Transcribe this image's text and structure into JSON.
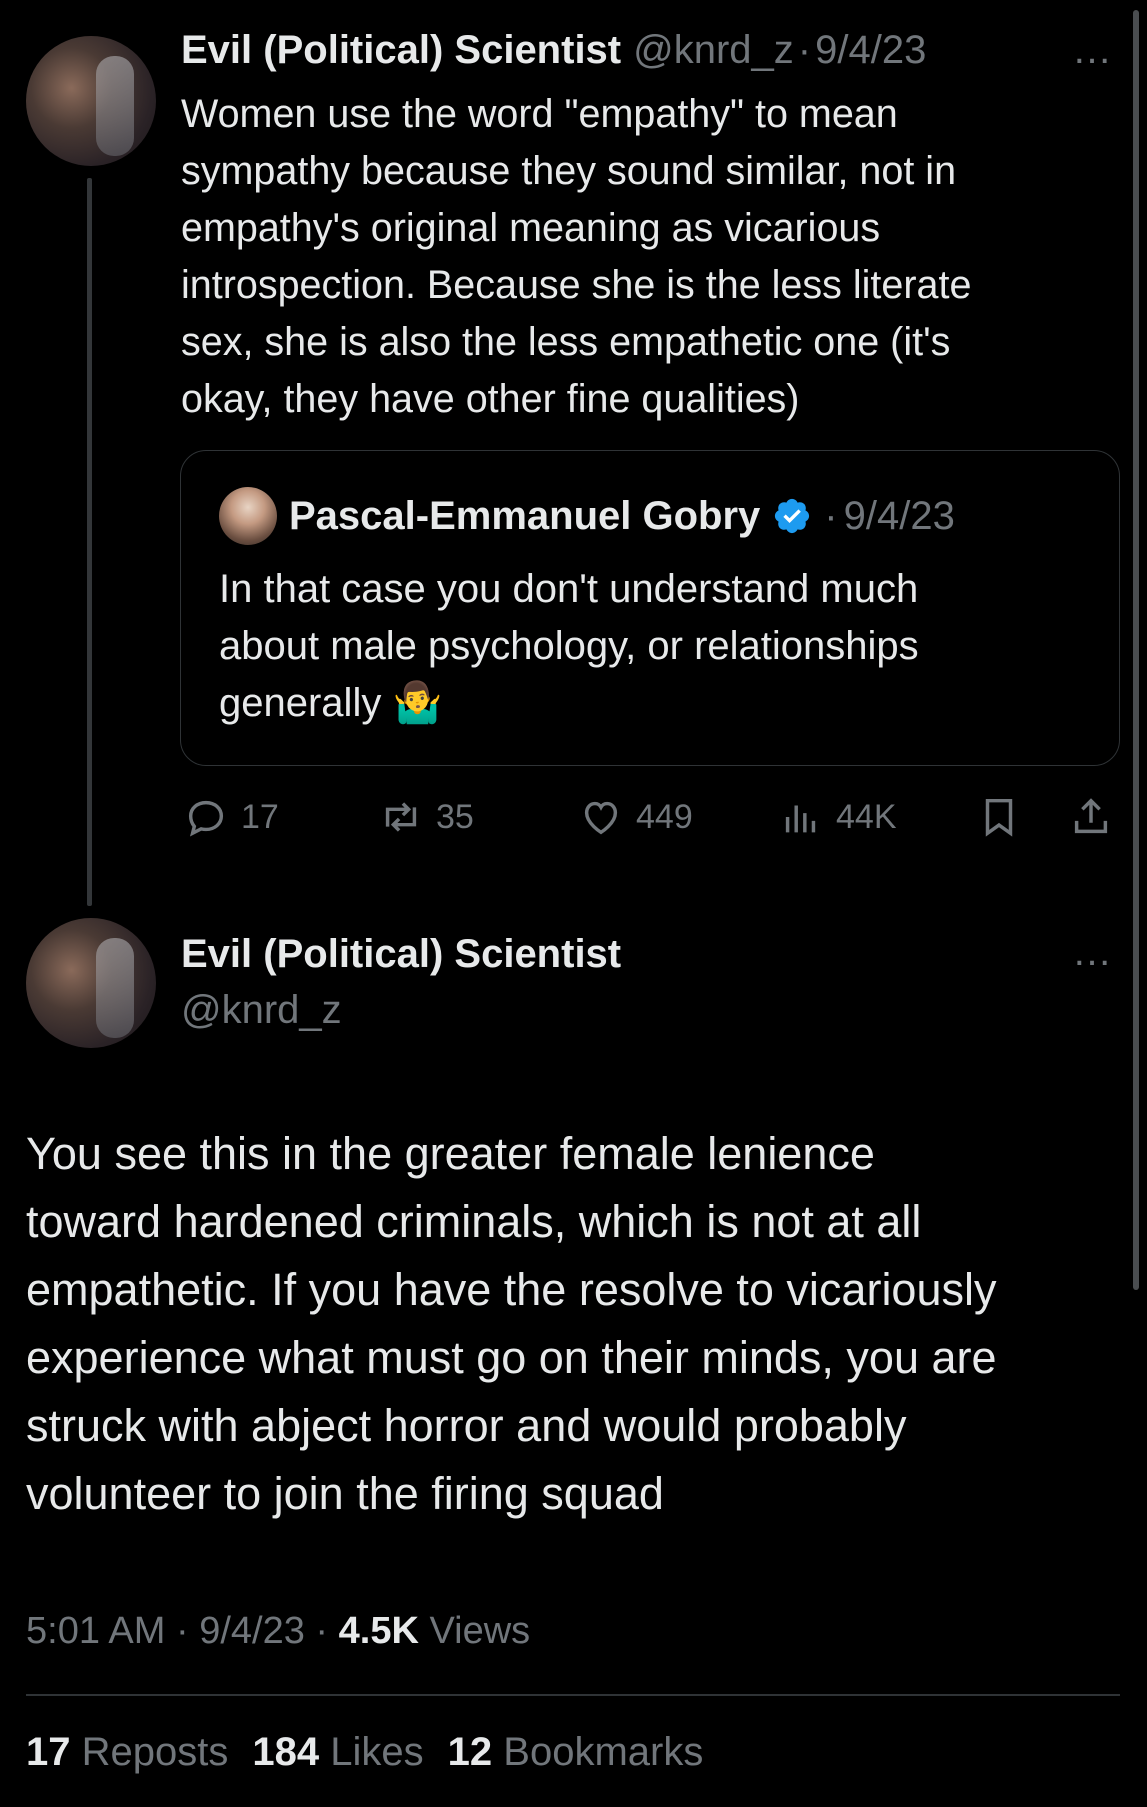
{
  "tweet1": {
    "author_name": "Evil (Political) Scientist",
    "handle": "@knrd_z",
    "separator": "·",
    "date": "9/4/23",
    "more_icon": "…",
    "lines": [
      "Women use the word \"empathy\" to mean",
      "sympathy because they sound similar, not in",
      "empathy's original meaning as vicarious",
      "introspection. Because she is the less literate",
      "sex, she is also the less empathetic one (it's",
      "okay, they have other fine qualities)"
    ],
    "quote": {
      "author_name": "Pascal-Emmanuel Gobry",
      "separator": "·",
      "date": "9/4/23",
      "lines": [
        "In that case you don't understand much",
        "about male psychology, or relationships",
        "generally 🤷‍♂️"
      ]
    },
    "actions": {
      "replies": "17",
      "reposts": "35",
      "likes": "449",
      "views": "44K"
    }
  },
  "tweet2": {
    "author_name": "Evil (Political) Scientist",
    "handle": "@knrd_z",
    "more_icon": "…",
    "lines": [
      "You see this in the greater female lenience",
      "toward hardened criminals, which is not at all",
      "empathetic. If you have the resolve to vicariously",
      "experience what must go on their minds, you are",
      "struck with abject horror and would probably",
      "volunteer to join the firing squad"
    ],
    "time": "5:01 AM",
    "date": "9/4/23",
    "sep": "·",
    "views_count": "4.5K",
    "views_label": "Views",
    "reposts_count": "17",
    "reposts_label": "Reposts",
    "likes_count": "184",
    "likes_label": "Likes",
    "bookmarks_count": "12",
    "bookmarks_label": "Bookmarks"
  },
  "colors": {
    "background": "#000000",
    "text": "#e7e9ea",
    "muted": "#71767b",
    "verified": "#1d9bf0",
    "border": "#2f3336"
  }
}
